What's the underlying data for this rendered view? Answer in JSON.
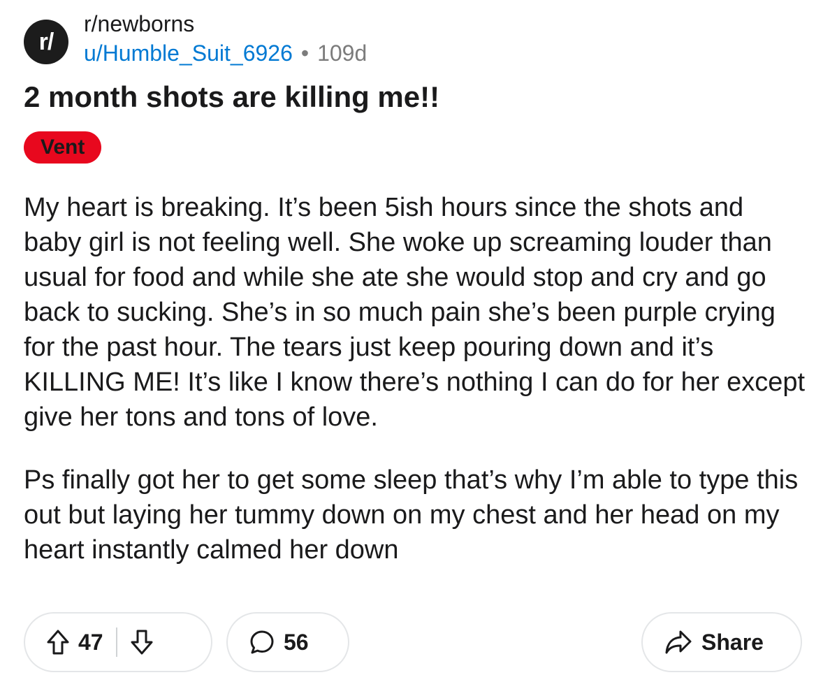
{
  "post": {
    "subreddit": "r/newborns",
    "subreddit_icon_text": "r/",
    "author": "u/Humble_Suit_6926",
    "separator": "•",
    "age": "109d",
    "title": "2 month shots are killing me!!",
    "flair": "Vent",
    "body": [
      "My heart is breaking. It’s been 5ish hours since the shots and baby girl is not feeling well. She woke up screaming louder than usual for food and while she ate she would stop and cry and go back to sucking. She’s in so much pain she’s been purple crying for the past hour. The tears just keep pouring down and it’s KILLING ME! It’s like I know there’s nothing I can do for her except give her tons and tons of love.",
      "Ps finally got her to get some sleep that’s why I’m able to type this out but laying her tummy down on my chest and her head on my heart instantly calmed her down"
    ]
  },
  "actions": {
    "upvote_icon": "arrow-up-icon",
    "downvote_icon": "arrow-down-icon",
    "score": "47",
    "comment_icon": "comment-bubble-icon",
    "comments": "56",
    "share_icon": "share-arrow-icon",
    "share_label": "Share"
  },
  "colors": {
    "flair_bg": "#e8081e",
    "username": "#0079d3",
    "muted": "#7c7c7c",
    "avatar_bg": "#1c1c1c"
  }
}
